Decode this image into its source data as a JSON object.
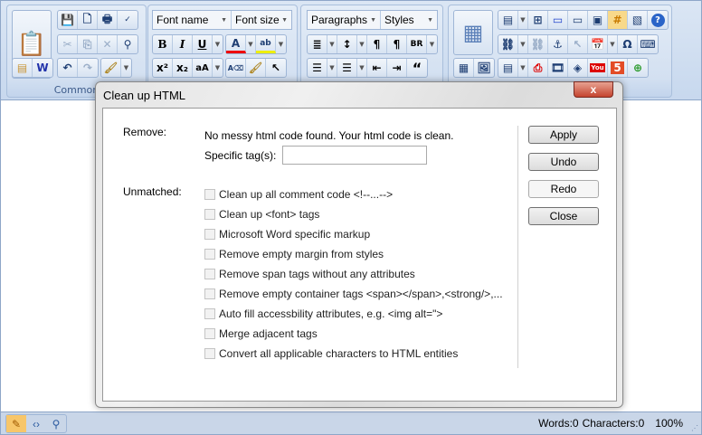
{
  "toolbar": {
    "common_label": "Common",
    "font_name": "Font name",
    "font_size": "Font size",
    "paragraphs": "Paragraphs",
    "styles": "Styles"
  },
  "dialog": {
    "title": "Clean up HTML",
    "close_glyph": "x",
    "remove_label": "Remove:",
    "message": "No messy html code found. Your html code is clean.",
    "specific_tags_label": "Specific tag(s):",
    "specific_tags_value": "",
    "unmatched_label": "Unmatched:",
    "options": [
      {
        "label": "Clean up all comment code <!--...-->",
        "checked": false
      },
      {
        "label": "Clean up <font> tags",
        "checked": false
      },
      {
        "label": "Microsoft Word specific markup",
        "checked": false
      },
      {
        "label": "Remove empty margin from styles",
        "checked": false
      },
      {
        "label": "Remove span tags without any attributes",
        "checked": false
      },
      {
        "label": "Remove empty container tags <span></span>,<strong/>,...",
        "checked": false
      },
      {
        "label": "Auto fill accessbility attributes, e.g. <img alt=\">",
        "checked": false
      },
      {
        "label": "Merge adjacent tags",
        "checked": false
      },
      {
        "label": "Convert all applicable characters to HTML entities",
        "checked": false
      }
    ],
    "buttons": {
      "apply": "Apply",
      "undo": "Undo",
      "redo": "Redo",
      "close": "Close"
    }
  },
  "status": {
    "words": "Words:0",
    "characters": "Characters:0",
    "zoom": "100%"
  }
}
